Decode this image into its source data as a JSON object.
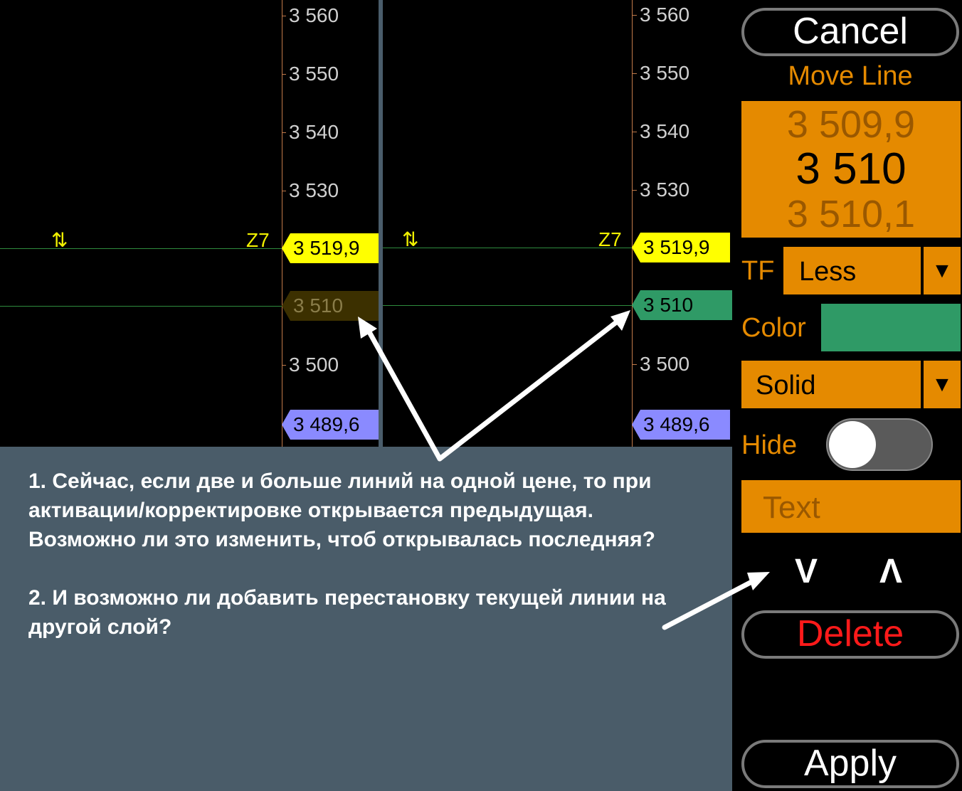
{
  "charts": [
    {
      "ticks": [
        "3 560",
        "3 550",
        "3 540",
        "3 530",
        "3 500"
      ],
      "symbol": "⇅",
      "zone": "Z7",
      "tags": [
        "3 519,9",
        "3 510",
        "3 489,6"
      ]
    },
    {
      "ticks": [
        "3 560",
        "3 550",
        "3 540",
        "3 530",
        "3 500"
      ],
      "symbol": "⇅",
      "zone": "Z7",
      "tags": [
        "3 519,9",
        "3 510",
        "3 489,6"
      ]
    }
  ],
  "colors": {
    "tag_yellow": "#ffff00",
    "tag_olive": "#3c3000",
    "tag_green": "#2f9a66",
    "tag_purple": "#8a8aff",
    "accent_orange": "#e58a00",
    "delete_red": "#ff1a1a"
  },
  "note": {
    "p1": "1. Сейчас, если две и больше линий на одной цене, то при активации/корректировке открывается предыдущая. Возможно ли это изменить, чтоб открывалась последняя?",
    "p2": "2. И возможно ли добавить перестановку текущей линии на другой слой?"
  },
  "panel": {
    "cancel": "Cancel",
    "title": "Move Line",
    "price_prev": "3 509,9",
    "price_current": "3 510",
    "price_next": "3 510,1",
    "tf_label": "TF",
    "tf_value": "Less",
    "color_label": "Color",
    "color_value": "#2f9a66",
    "style_value": "Solid",
    "hide_label": "Hide",
    "hide_on": false,
    "text_placeholder": "Text",
    "down_arrow": "V",
    "up_arrow": "Λ",
    "delete": "Delete",
    "apply": "Apply"
  }
}
